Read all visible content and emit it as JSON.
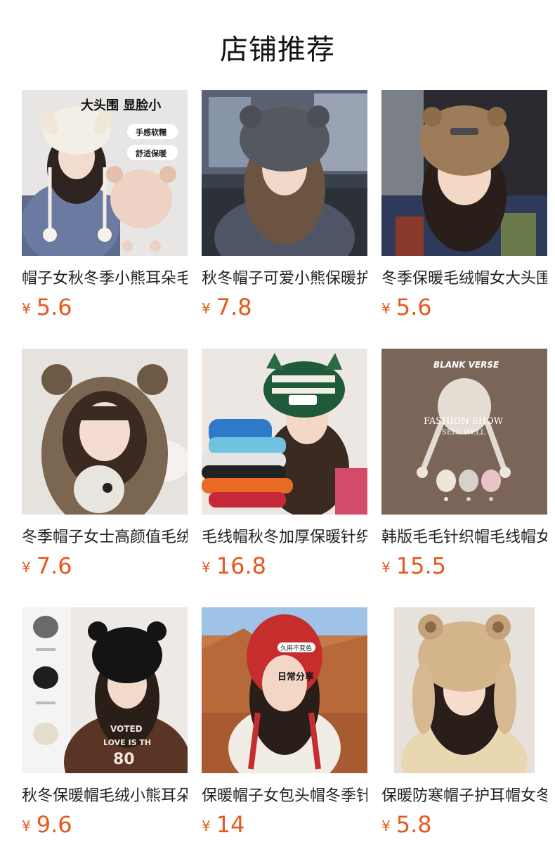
{
  "page": {
    "title": "店铺推荐"
  },
  "products": [
    {
      "name": "帽子女秋冬季小熊耳朵毛绒保暖护耳帽",
      "currency": "¥",
      "price": "5.6",
      "overlay": {
        "headline": "大头围 显脸小",
        "tags": [
          "手感软糯",
          "舒适保暖"
        ]
      }
    },
    {
      "name": "秋冬帽子可爱小熊保暖护耳毛线帽",
      "currency": "¥",
      "price": "7.8"
    },
    {
      "name": "冬季保暖毛绒帽女大头围显脸小",
      "currency": "¥",
      "price": "5.6"
    },
    {
      "name": "冬季帽子女士高颜值毛绒小熊耳朵",
      "currency": "¥",
      "price": "7.6"
    },
    {
      "name": "毛线帽秋冬加厚保暖针织帽",
      "currency": "¥",
      "price": "16.8"
    },
    {
      "name": "韩版毛毛针织帽毛线帽女冬季",
      "currency": "¥",
      "price": "15.5",
      "overlay": {
        "brand": "BLANK VERSE",
        "line1": "FASHION SHOW",
        "line2": "SELL WELL"
      }
    },
    {
      "name": "秋冬保暖帽毛绒小熊耳朵护耳帽",
      "currency": "¥",
      "price": "9.6",
      "overlay": {
        "shirt_text1": "VOTED",
        "shirt_text2": "LOVE IS TH",
        "shirt_num": "80"
      }
    },
    {
      "name": "保暖帽子女包头帽冬季针织",
      "currency": "¥",
      "price": "14",
      "overlay": {
        "badge": "久用不变色",
        "caption": "日常分享"
      }
    },
    {
      "name": "保暖防寒帽子护耳帽女冬季",
      "currency": "¥",
      "price": "5.8"
    }
  ],
  "colors": {
    "price": "#e55a1c",
    "text": "#222222"
  }
}
